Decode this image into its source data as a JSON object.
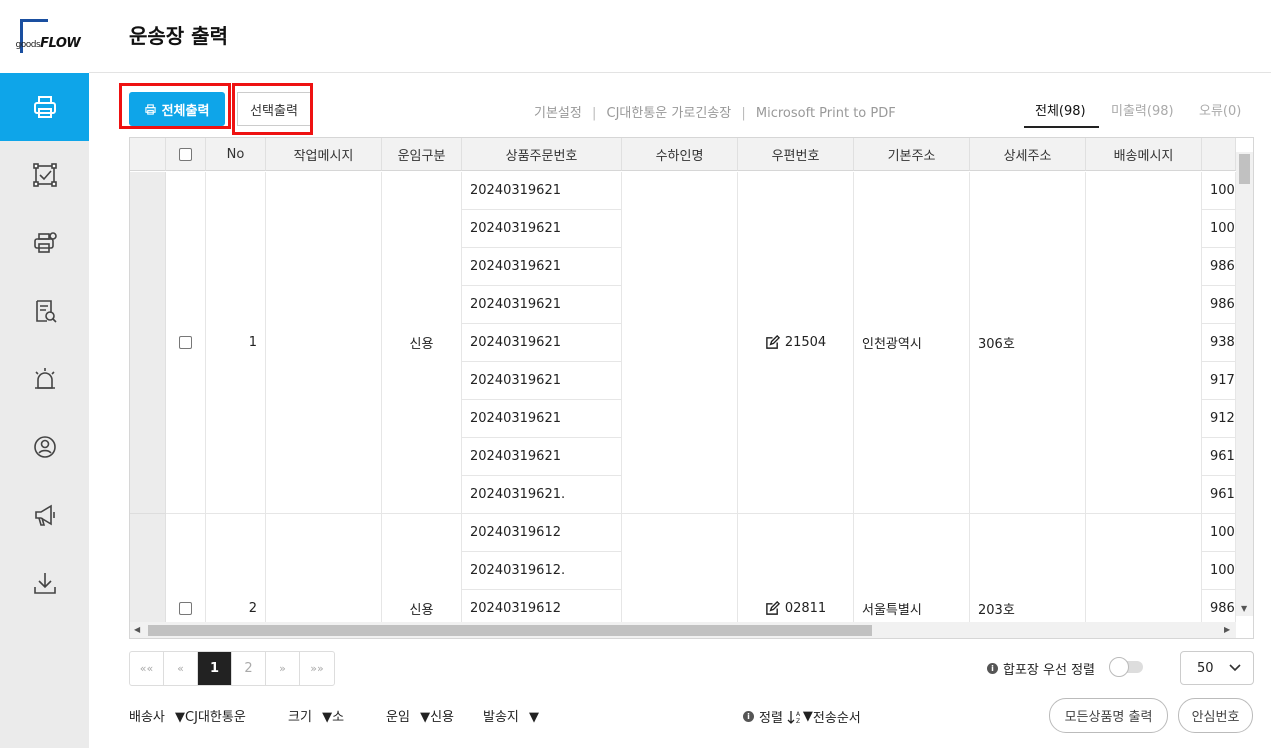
{
  "logo": {
    "small": "goods",
    "big": "FLOW"
  },
  "page_title": "운송장 출력",
  "toolbar": {
    "print_all": "전체출력",
    "print_selected": "선택출력",
    "settings": [
      "기본설정",
      "CJ대한통운 가로긴송장",
      "Microsoft Print to PDF"
    ],
    "separator": "|"
  },
  "tabs": [
    {
      "label": "전체(98)",
      "active": true
    },
    {
      "label": "미출력(98)",
      "active": false
    },
    {
      "label": "오류(0)",
      "active": false
    }
  ],
  "table": {
    "headers": [
      "No",
      "작업메시지",
      "운임구분",
      "상품주문번호",
      "수하인명",
      "우편번호",
      "기본주소",
      "상세주소",
      "배송메시지"
    ],
    "rows": [
      {
        "no": "1",
        "fare": "신용",
        "orders": [
          "20240319621",
          "20240319621",
          "20240319621",
          "20240319621",
          "20240319621",
          "20240319621",
          "20240319621",
          "20240319621",
          "20240319621."
        ],
        "zip": "21504",
        "address": "인천광역시",
        "detail": "306호",
        "trailing": [
          "100",
          "100",
          "986",
          "986",
          "938",
          "917",
          "912",
          "961",
          "961"
        ]
      },
      {
        "no": "2",
        "fare": "신용",
        "orders": [
          "20240319612",
          "20240319612.",
          "20240319612"
        ],
        "zip": "02811",
        "address": "서울특별시",
        "detail": "203호",
        "trailing": [
          "100",
          "100",
          "986"
        ]
      }
    ]
  },
  "pager": {
    "first": "«««",
    "prev": "«",
    "pages": [
      "1",
      "2"
    ],
    "current": "1",
    "next": "»",
    "last": "»»"
  },
  "pager_labels": {
    "first": "««",
    "prev": "«",
    "next": "»",
    "last": "»»"
  },
  "priority_sort": {
    "label": "합포장 우선 정렬",
    "enabled": false
  },
  "page_size": "50",
  "footer": {
    "carrier_label": "배송사",
    "carrier_value": "CJ대한통운",
    "size_label": "크기",
    "size_value": "소",
    "fare_label": "운임",
    "fare_value": "신용",
    "sender_label": "발송지",
    "sender_value": "",
    "sort_label": "정렬",
    "sort_value": "전송순서",
    "print_all_names": "모든상품명 출력",
    "safe_number": "안심번호"
  },
  "colors": {
    "accent": "#0ea5e9",
    "highlight": "#ee1111"
  }
}
